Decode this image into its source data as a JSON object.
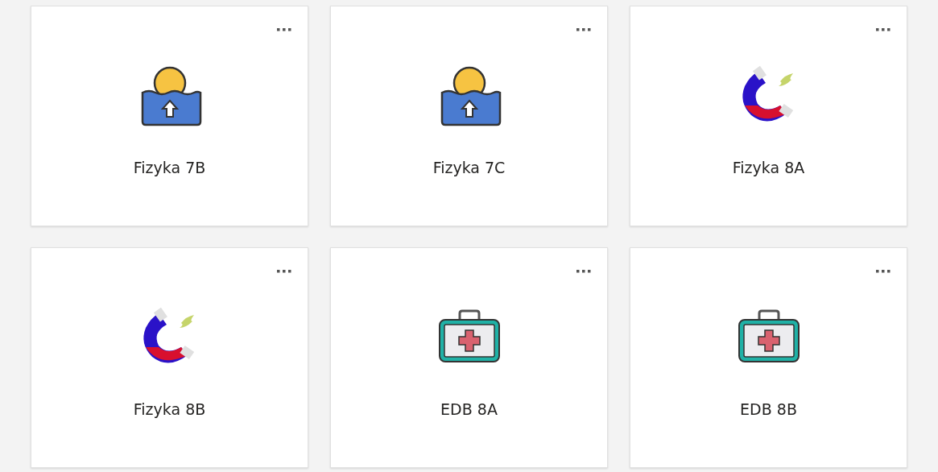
{
  "cards": [
    {
      "title": "Fizyka 7B",
      "kind": "water"
    },
    {
      "title": "Fizyka 7C",
      "kind": "water"
    },
    {
      "title": "Fizyka 8A",
      "kind": "magnet"
    },
    {
      "title": "Fizyka 8B",
      "kind": "magnet"
    },
    {
      "title": "EDB 8A",
      "kind": "aid"
    },
    {
      "title": "EDB 8B",
      "kind": "aid"
    }
  ]
}
